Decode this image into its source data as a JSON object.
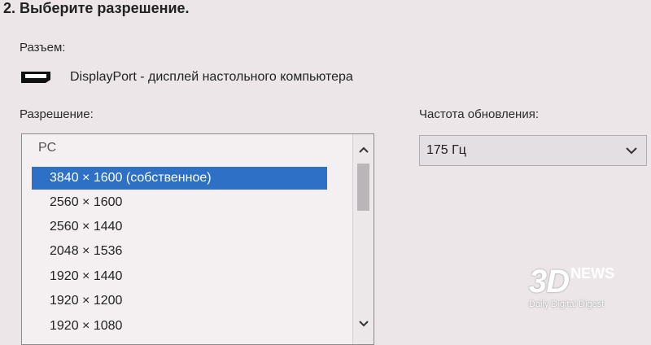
{
  "heading": "2. Выберите разрешение.",
  "connector": {
    "label": "Разъем:",
    "icon": "displayport-icon",
    "value": "DisplayPort - дисплей настольного компьютера"
  },
  "resolution": {
    "label": "Разрешение:",
    "group": "PC",
    "items": [
      "3840 × 1600 (собственное)",
      "2560 × 1600",
      "2560 × 1440",
      "2048 × 1536",
      "1920 × 1440",
      "1920 × 1200",
      "1920 × 1080"
    ],
    "selected_index": 0
  },
  "refresh": {
    "label": "Частота обновления:",
    "value": "175 Гц"
  },
  "watermark": {
    "logo": "3D",
    "news": "NEWS",
    "tagline": "Daily Digital Digest"
  },
  "colors": {
    "selection": "#2d70c5",
    "background": "#ece6e8"
  }
}
